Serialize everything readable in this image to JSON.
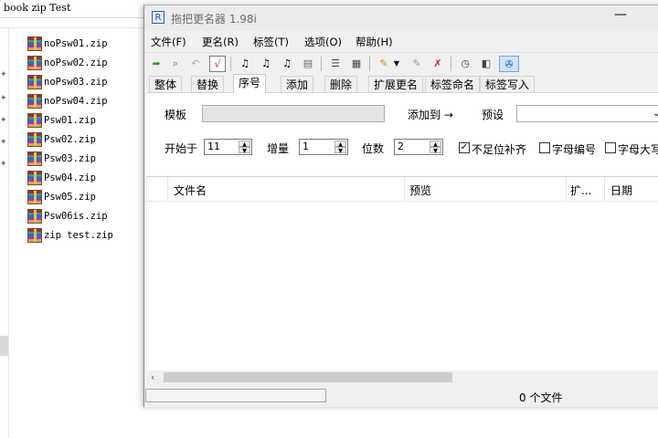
{
  "explorer": {
    "title": "book zip Test",
    "files": [
      "noPsw01.zip",
      "noPsw02.zip",
      "noPsw03.zip",
      "noPsw04.zip",
      "Psw01.zip",
      "Psw02.zip",
      "Psw03.zip",
      "Psw04.zip",
      "Psw05.zip",
      "Psw06is.zip",
      "zip test.zip"
    ]
  },
  "window": {
    "title": "拖把更名器 1.98i",
    "icon_name": "app-icon",
    "minimize_glyph": "—"
  },
  "menu": [
    "文件(F)",
    "更名(R)",
    "标签(T)",
    "选项(O)",
    "帮助(H)"
  ],
  "toolbar": {
    "icons": [
      "open-folder-icon",
      "search-icon",
      "undo-icon",
      "apply-check-icon",
      "tag-read-icon",
      "tag-write-icon",
      "tag-copy-icon",
      "tag-paste-icon",
      "list-icon",
      "document-icon",
      "pen-icon",
      "dropdown-arrow-icon",
      "eraser-icon",
      "clear-icon",
      "clock-icon",
      "view-icon",
      "settings-icon"
    ]
  },
  "tabs": [
    "整体",
    "替换",
    "序号",
    "添加",
    "删除",
    "扩展更名",
    "标签命名",
    "标签写入"
  ],
  "active_tab": "序号",
  "panel": {
    "template_label": "模板",
    "template_value": "",
    "add_to_label": "添加到 →",
    "preset_label": "预设",
    "preset_value": "",
    "start_label": "开始于",
    "start_value": "11",
    "increment_label": "增量",
    "increment_value": "1",
    "digits_label": "位数",
    "digits_value": "2",
    "pad_label": "不足位补齐",
    "pad_checked": true,
    "letter_number_label": "字母编号",
    "letter_number_checked": false,
    "uppercase_label": "字母大写",
    "uppercase_checked": false
  },
  "list": {
    "columns": [
      "文件名",
      "预览",
      "扩...",
      "日期"
    ],
    "rows": []
  },
  "status": {
    "file_count": "0 个文件"
  }
}
